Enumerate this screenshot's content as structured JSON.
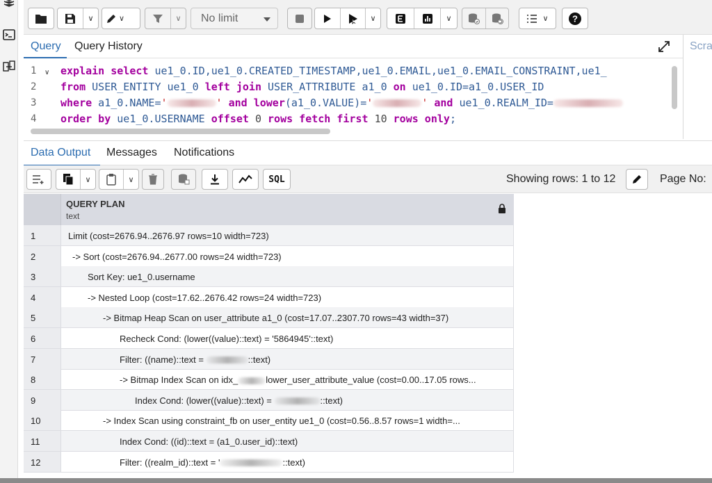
{
  "toolbar": {
    "limit_select": "No limit"
  },
  "query_tabs": {
    "query": "Query",
    "history": "Query History",
    "scratch": "Scra"
  },
  "editor": {
    "line_numbers": [
      "1",
      "2",
      "3",
      "4"
    ],
    "line1": {
      "kw1": "explain",
      "kw2": "select",
      "rest": " ue1_0.ID,ue1_0.CREATED_TIMESTAMP,ue1_0.EMAIL,ue1_0.EMAIL_CONSTRAINT,ue1_"
    },
    "line2": {
      "kw_from": "from",
      "t1": " USER_ENTITY ue1_0 ",
      "kw_join": "left join",
      "t2": " USER_ATTRIBUTE a1_0 ",
      "kw_on": "on",
      "t3": " ue1_0.ID=a1_0.USER_ID"
    },
    "line3": {
      "kw_where": "where",
      "t1": " a1_0.NAME=",
      "q1": "'",
      "q1end": "'",
      "kw_and1": "and",
      "fn_lower": "lower",
      "t2": "(a1_0.VALUE)=",
      "q2": "'",
      "q2end": "'",
      "kw_and2": "and",
      "t3": " ue1_0.REALM_ID="
    },
    "line4": {
      "kw_order": "order by",
      "t1": " ue1_0.USERNAME ",
      "kw_offset": "offset",
      "n0": "0",
      "kw_rows": "rows fetch first",
      "n10": "10",
      "kw_only": "rows only",
      "semi": ";"
    }
  },
  "output_tabs": {
    "data_output": "Data Output",
    "messages": "Messages",
    "notifications": "Notifications"
  },
  "output_toolbar": {
    "sql_label": "SQL",
    "showing": "Showing rows: 1 to 12",
    "page_no": "Page No:"
  },
  "grid": {
    "column_name": "QUERY PLAN",
    "column_type": "text",
    "rows": [
      {
        "n": "1",
        "a": "Limit  (cost=2676.94..2676.97 rows=10 width=723)",
        "b": ""
      },
      {
        "n": "2",
        "a": "-> Sort  (cost=2676.94..2677.00 rows=24 width=723)",
        "b": ""
      },
      {
        "n": "3",
        "a": "Sort Key: ue1_0.username",
        "b": ""
      },
      {
        "n": "4",
        "a": "-> Nested Loop  (cost=17.62..2676.42 rows=24 width=723)",
        "b": ""
      },
      {
        "n": "5",
        "a": "-> Bitmap Heap Scan on user_attribute a1_0  (cost=17.07..2307.70 rows=43 width=37)",
        "b": ""
      },
      {
        "n": "6",
        "a": "Recheck Cond: (lower((value)::text) = '5864945'::text)",
        "b": ""
      },
      {
        "n": "7",
        "a": "Filter: ((name)::text = ",
        "b": "::text)"
      },
      {
        "n": "8",
        "a": "-> Bitmap Index Scan on idx_",
        "b": "lower_user_attribute_value  (cost=0.00..17.05 rows..."
      },
      {
        "n": "9",
        "a": "Index Cond: (lower((value)::text) = ",
        "b": "::text)"
      },
      {
        "n": "10",
        "a": "-> Index Scan using constraint_fb on user_entity ue1_0  (cost=0.56..8.57 rows=1 width=...",
        "b": ""
      },
      {
        "n": "11",
        "a": "Index Cond: ((id)::text = (a1_0.user_id)::text)",
        "b": ""
      },
      {
        "n": "12",
        "a": "Filter: ((realm_id)::text = '",
        "b": "::text)"
      }
    ]
  },
  "colors": {
    "accent": "#2b6cb0",
    "keyword": "#a3009e",
    "identifier": "#2f5a95",
    "header_bg": "#d9dbe2"
  }
}
